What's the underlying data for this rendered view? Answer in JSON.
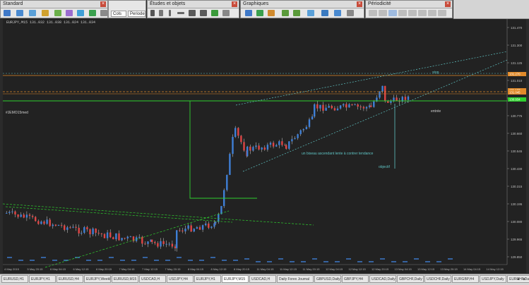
{
  "toolbars": {
    "standard": {
      "title": "Standard",
      "close": "×"
    },
    "periodes": {
      "value1": "Cols",
      "value2": "Periode"
    },
    "objets": {
      "title": "Études et objets",
      "close": "×"
    },
    "graphiques": {
      "title": "Graphiques",
      "close": "×"
    },
    "periodicite": {
      "title": "Périodicité",
      "close": "×"
    }
  },
  "chart": {
    "symbol_line": "EURJPY,M15  131.032 131.038 131.024 131.034",
    "left_label": "#JEMO15med",
    "label_stop": "stop",
    "label_entry": "entrée",
    "label_objectif": "objectif",
    "annotation": "un biseau ascendant lente à contrer tendance",
    "price_ticks": [
      "131.470",
      "131.300",
      "131.125",
      "131.010",
      "130.895",
      "130.775",
      "130.660",
      "130.545",
      "130.430",
      "130.315",
      "130.195",
      "130.080",
      "129.965",
      "129.850"
    ],
    "price_badges": [
      "131.270",
      "131.137",
      "131.045",
      "130.934"
    ],
    "time_ticks": [
      "4 May 2015",
      "5 May 20:15",
      "6 May 04:15",
      "6 May 12:15",
      "6 May 20:15",
      "7 May 04:15",
      "7 May 12:15",
      "7 May 20:15",
      "8 May 04:15",
      "8 May 12:15",
      "8 May 20:15",
      "11 May 04:15",
      "11 May 12:15",
      "11 May 20:15",
      "12 May 04:15",
      "12 May 12:15",
      "12 May 20:15",
      "13 May 04:15",
      "13 May 12:15",
      "13 May 20:15",
      "14 May 04:15",
      "14 May 12:15"
    ],
    "colors": {
      "bg": "#222222",
      "bull": "#3f7fd6",
      "bear": "#e04545",
      "line_green": "#2fd02f",
      "line_orange": "#e08a2a",
      "line_cyan": "#5fc4c4"
    }
  },
  "tabs": [
    "EURUSD,H1",
    "EURJPY,H1",
    "EURUSD,H4",
    "EURJPY,Weekly",
    "EURUSD,M15",
    "USDCAD,H",
    "USDJPY,H4",
    "EURJPY,H1",
    "EURJPY,M15",
    "USDCAD,H",
    "Daily Forex Journal",
    "GBPUSD,Daily",
    "GBPJPY,H4",
    "USDCAD,Daily",
    "GBPCHF,Daily",
    "USDCHF,Daily",
    "EURGBP,H4",
    "USDJPY,Daily",
    "EURCHF,Daily"
  ]
}
